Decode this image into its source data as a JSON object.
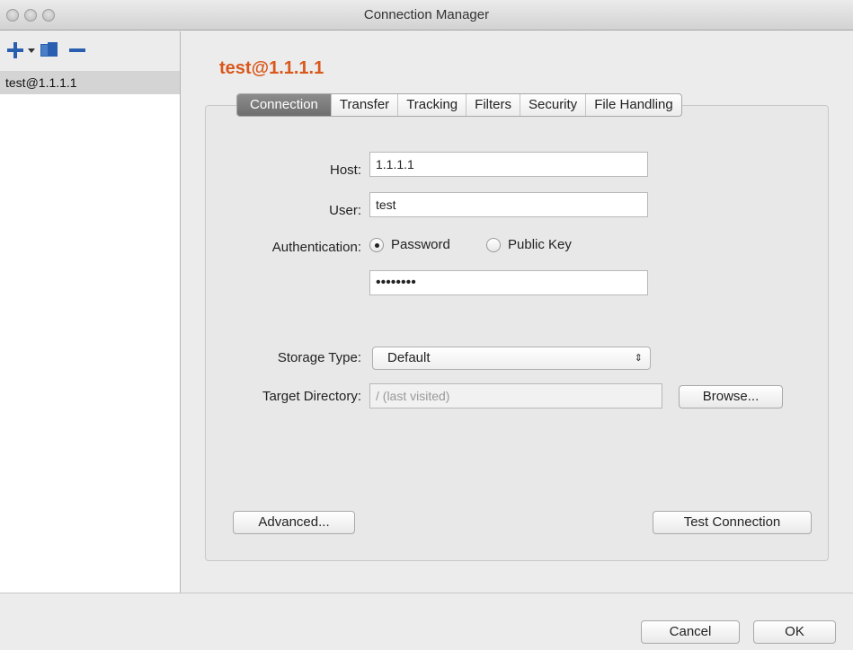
{
  "window": {
    "title": "Connection Manager"
  },
  "sidebar": {
    "toolbar": {
      "add_icon": "plus-icon",
      "dropdown_icon": "caret-down-icon",
      "duplicate_icon": "duplicate-icon",
      "remove_icon": "minus-icon"
    },
    "items": [
      {
        "label": "test@1.1.1.1",
        "selected": true
      }
    ]
  },
  "main": {
    "connection_title": "test@1.1.1.1",
    "tabs": [
      {
        "label": "Connection",
        "active": true
      },
      {
        "label": "Transfer",
        "active": false
      },
      {
        "label": "Tracking",
        "active": false
      },
      {
        "label": "Filters",
        "active": false
      },
      {
        "label": "Security",
        "active": false
      },
      {
        "label": "File Handling",
        "active": false
      }
    ],
    "form": {
      "host_label": "Host:",
      "host_value": "1.1.1.1",
      "user_label": "User:",
      "user_value": "test",
      "auth_label": "Authentication:",
      "auth_options": [
        {
          "label": "Password",
          "checked": true
        },
        {
          "label": "Public Key",
          "checked": false
        }
      ],
      "password_value": "••••••••",
      "storage_label": "Storage Type:",
      "storage_value": "Default",
      "target_label": "Target Directory:",
      "target_placeholder": "/ (last visited)",
      "browse_label": "Browse..."
    },
    "advanced_label": "Advanced...",
    "test_connection_label": "Test Connection"
  },
  "footer": {
    "cancel_label": "Cancel",
    "ok_label": "OK"
  }
}
